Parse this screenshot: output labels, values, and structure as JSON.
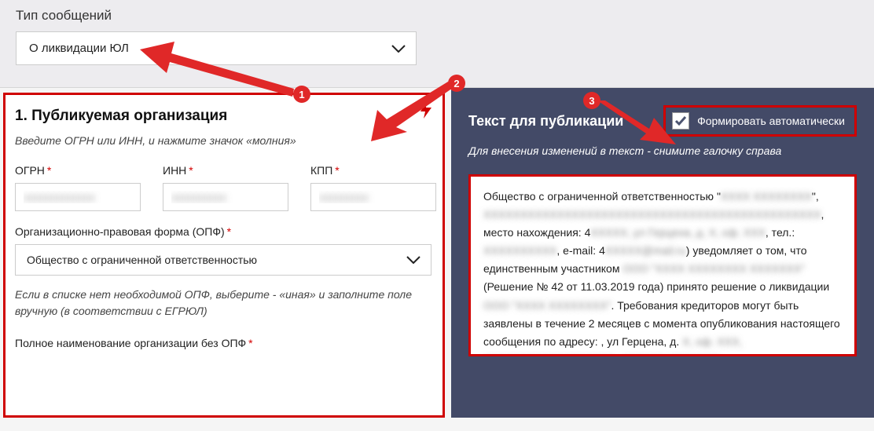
{
  "top": {
    "label": "Тип сообщений",
    "selected": "О ликвидации ЮЛ"
  },
  "left": {
    "title": "1. Публикуемая организация",
    "hint": "Введите ОГРН или ИНН, и нажмите значок «молния»",
    "ogrn_label": "ОГРН",
    "inn_label": "ИНН",
    "kpp_label": "КПП",
    "ogrn_value": "xxxxxxxxxxxxx",
    "inn_value": "xxxxxxxxxx",
    "kpp_value": "xxxxxxxxx",
    "opf_label": "Организационно-правовая форма (ОПФ)",
    "opf_selected": "Общество с ограниченной ответственностью",
    "opf_hint": "Если в списке нет необходимой ОПФ, выберите - «иная» и заполните поле вручную (в соответствии с ЕГРЮЛ)",
    "full_name_label": "Полное наименование организации без ОПФ"
  },
  "right": {
    "title": "Текст для публикации",
    "auto_label": "Формировать автоматически",
    "auto_checked": true,
    "subhint": "Для внесения изменений в текст - снимите галочку справа",
    "body_parts": [
      "Общество с ограниченной ответственностью \"",
      "XXXX XXXXXXXX",
      "\", ",
      "XXXXXXXXXXXXXXXXXXXXXXXXXXXXXXXXXXXXXXXXXXXXXX",
      ", место нахождения: 4",
      "XXXXX, ул Герцена, д. X, оф. XXX",
      ", тел.: ",
      "XXXXXXXXXX",
      ", e-mail: 4",
      "XXXXX@mail.ru",
      ") уведомляет о том, что единственным участником ",
      "ООО \"XXXX XXXXXXXX XXXXXXX\"",
      " (Решение № 42 от 11.03.2019 года) принято решение о ликвидации ",
      "ООО \"XXXX XXXXXXXX\"",
      ". Требования кредиторов могут быть заявлены в течение 2 месяцев с момента опубликования настоящего сообщения по адресу: , ул Герцена, д. ",
      "X, оф. XXX, XXXXXXXXXXXXXXXXXX, XXXXXX XXXXXXX",
      "."
    ]
  },
  "callouts": {
    "n1": "1",
    "n2": "2",
    "n3": "3"
  }
}
